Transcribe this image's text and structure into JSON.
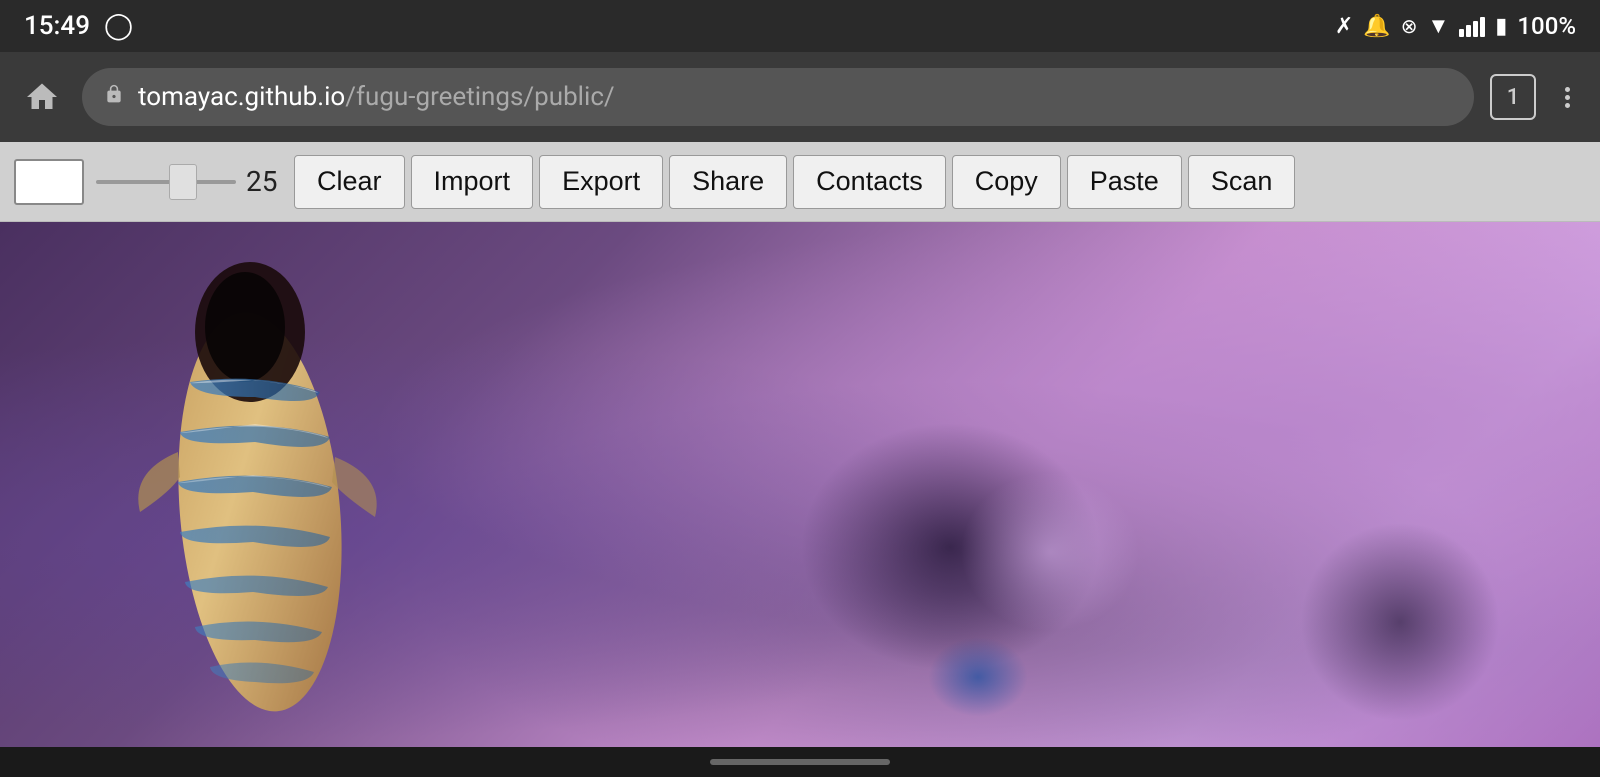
{
  "statusBar": {
    "time": "15:49",
    "batteryPercent": "100%",
    "tabCount": "1"
  },
  "browserBar": {
    "urlDomain": "tomayac.github.io",
    "urlPath": "/fugu-greetings/public/",
    "homeLabel": "home"
  },
  "toolbar": {
    "sliderValue": "25",
    "buttons": [
      {
        "id": "clear",
        "label": "Clear"
      },
      {
        "id": "import",
        "label": "Import"
      },
      {
        "id": "export",
        "label": "Export"
      },
      {
        "id": "share",
        "label": "Share"
      },
      {
        "id": "contacts",
        "label": "Contacts"
      },
      {
        "id": "copy",
        "label": "Copy"
      },
      {
        "id": "paste",
        "label": "Paste"
      },
      {
        "id": "scan",
        "label": "Scan"
      }
    ]
  },
  "navBar": {
    "handle": "gesture-handle"
  }
}
